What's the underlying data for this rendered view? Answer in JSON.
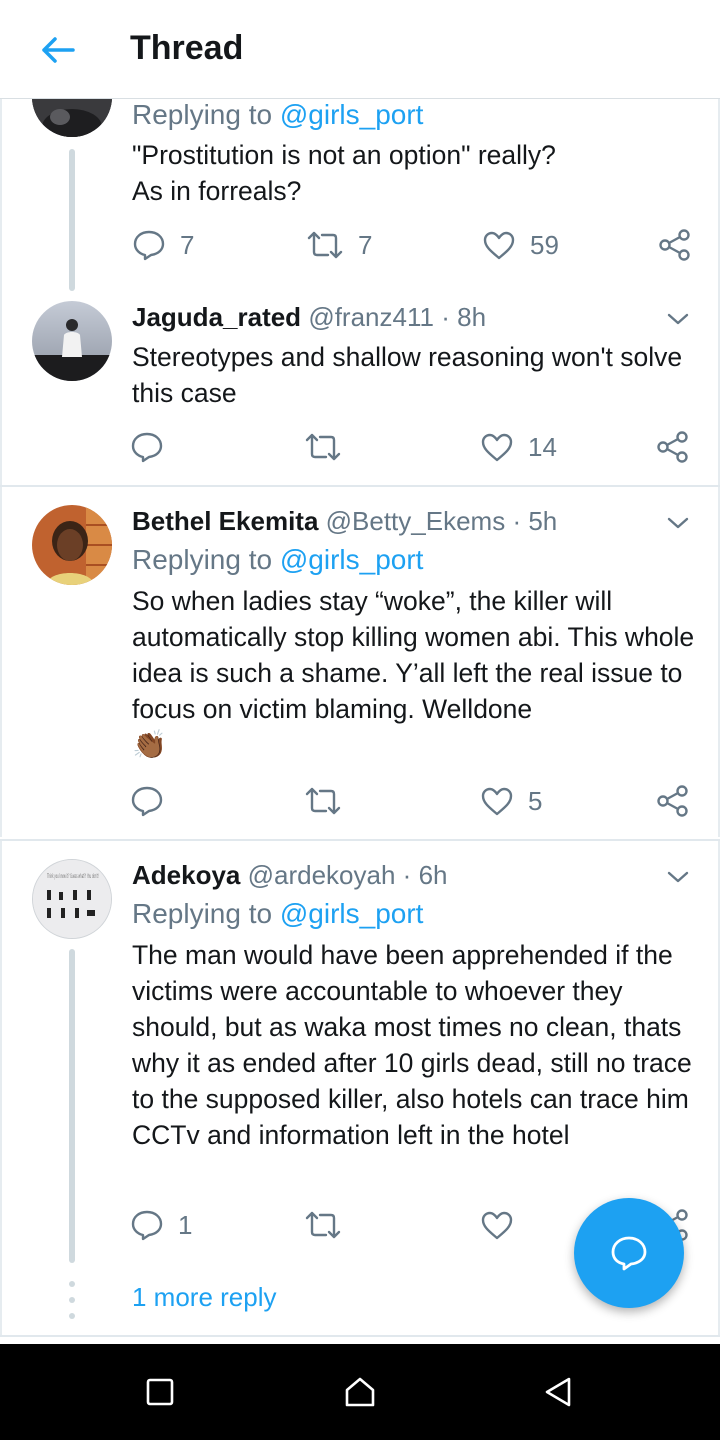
{
  "header": {
    "title": "Thread"
  },
  "tweets": [
    {
      "reply_prefix": "Replying to ",
      "reply_mention": "@girls_port",
      "text_line1": "\"Prostitution is not an option\" really?",
      "text_line2": "As in forreals?",
      "reply_count": "7",
      "retweet_count": "7",
      "like_count": "59"
    },
    {
      "name": "Jaguda_rated",
      "handle": "@franz411",
      "time": "8h",
      "text": "Stereotypes and shallow reasoning won't solve this case",
      "reply_count": "",
      "retweet_count": "",
      "like_count": "14"
    },
    {
      "name": "Bethel Ekemita",
      "handle": "@Betty_Ekems",
      "time": "5h",
      "reply_prefix": "Replying to ",
      "reply_mention": "@girls_port",
      "text": "So when ladies stay “woke”, the killer will automatically stop killing women abi. This whole idea is such a shame. Y’all left the real issue to focus on victim blaming. Welldone",
      "emoji": "👏🏾",
      "reply_count": "",
      "retweet_count": "",
      "like_count": "5"
    },
    {
      "name": "Adekoya",
      "handle": "@ardekoyah",
      "time": "6h",
      "reply_prefix": "Replying to ",
      "reply_mention": "@girls_port",
      "text": "The man would have been apprehended if the victims were accountable to whoever they should, but as waka most times no clean, thats why it as ended after 10 girls dead, still no trace to the supposed killer, also hotels can trace him CCTv and information left in the hotel",
      "avatar_text": "Think you know it? Guess what?! You don't!",
      "reply_count": "1",
      "retweet_count": "",
      "like_count": ""
    }
  ],
  "more_replies": "1 more reply",
  "separator": "·",
  "colors": {
    "accent": "#1da1f2",
    "muted": "#657786",
    "text": "#14171a"
  }
}
